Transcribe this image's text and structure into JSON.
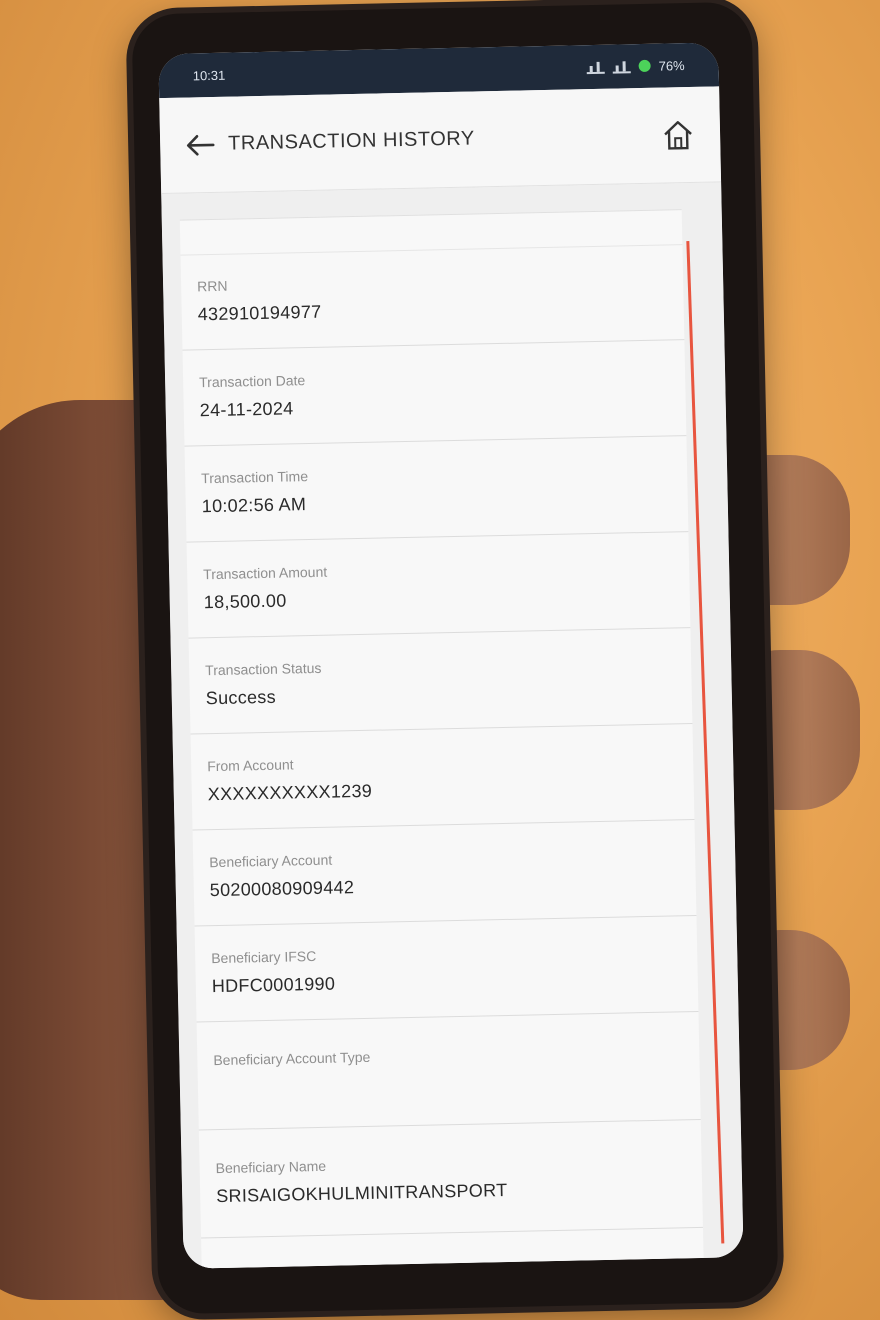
{
  "status_bar": {
    "time": "10:31",
    "battery": "76%"
  },
  "header": {
    "title": "TRANSACTION HISTORY",
    "back_icon": "arrow-left-icon",
    "home_icon": "home-icon"
  },
  "fields": [
    {
      "label": "RRN",
      "value": "432910194977"
    },
    {
      "label": "Transaction Date",
      "value": "24-11-2024"
    },
    {
      "label": "Transaction Time",
      "value": "10:02:56 AM"
    },
    {
      "label": "Transaction Amount",
      "value": "18,500.00"
    },
    {
      "label": "Transaction Status",
      "value": "Success"
    },
    {
      "label": "From Account",
      "value": "XXXXXXXXXX1239"
    },
    {
      "label": "Beneficiary Account",
      "value": "50200080909442"
    },
    {
      "label": "Beneficiary IFSC",
      "value": "HDFC0001990"
    },
    {
      "label": "Beneficiary Account Type",
      "value": ""
    },
    {
      "label": "Beneficiary Name",
      "value": "SRISAIGOKHULMINITRANSPORT"
    }
  ],
  "colors": {
    "scroll_accent": "#e8553f",
    "status_bar_bg": "#1f2a3a"
  }
}
